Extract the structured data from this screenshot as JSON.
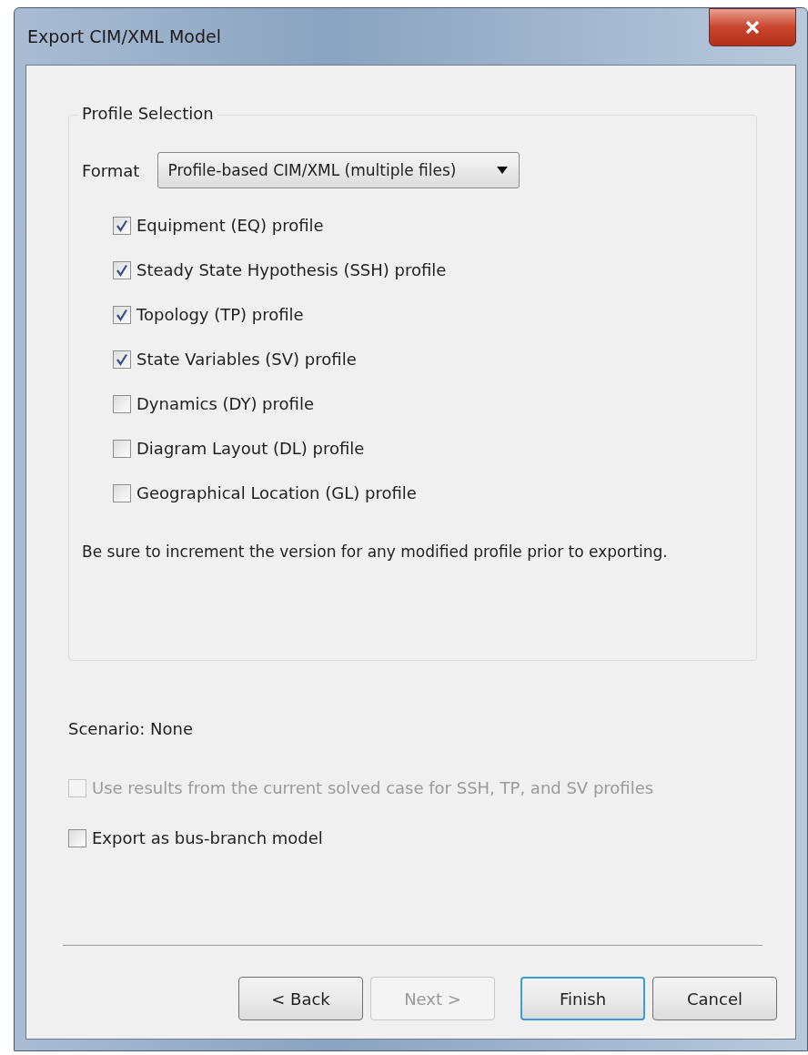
{
  "window": {
    "title": "Export CIM/XML Model"
  },
  "profile_selection": {
    "title": "Profile Selection",
    "format_label": "Format",
    "format_value": "Profile-based CIM/XML (multiple files)",
    "profiles": [
      {
        "label": "Equipment (EQ) profile",
        "checked": true
      },
      {
        "label": "Steady State Hypothesis (SSH) profile",
        "checked": true
      },
      {
        "label": "Topology (TP) profile",
        "checked": true
      },
      {
        "label": "State Variables (SV) profile",
        "checked": true
      },
      {
        "label": "Dynamics (DY) profile",
        "checked": false
      },
      {
        "label": "Diagram Layout (DL) profile",
        "checked": false
      },
      {
        "label": "Geographical Location (GL) profile",
        "checked": false
      }
    ],
    "note": "Be sure to increment the version for any modified profile prior to exporting."
  },
  "scenario": "Scenario: None",
  "options": [
    {
      "label": "Use results from the current solved case for SSH, TP, and SV profiles",
      "checked": false,
      "disabled": true
    },
    {
      "label": "Export as bus-branch model",
      "checked": false,
      "disabled": false
    }
  ],
  "buttons": [
    {
      "label": "< Back",
      "disabled": false,
      "default": false
    },
    {
      "label": "Next >",
      "disabled": true,
      "default": false
    },
    {
      "label": "Finish",
      "disabled": false,
      "default": true
    },
    {
      "label": "Cancel",
      "disabled": false,
      "default": false
    }
  ]
}
